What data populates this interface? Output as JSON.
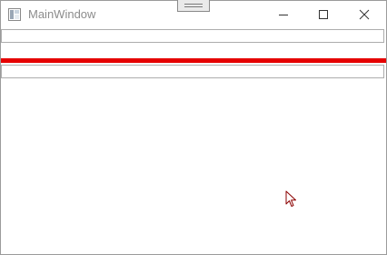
{
  "window": {
    "title": "MainWindow",
    "icon": "wpf-window-icon",
    "controls": [
      "minimize-icon",
      "maximize-icon",
      "close-icon"
    ]
  },
  "fields": {
    "top_value": "",
    "bottom_value": ""
  },
  "colors": {
    "accent_bar": "#e50000",
    "title_text": "#8c8c8c",
    "cursor": "#8b0000"
  }
}
